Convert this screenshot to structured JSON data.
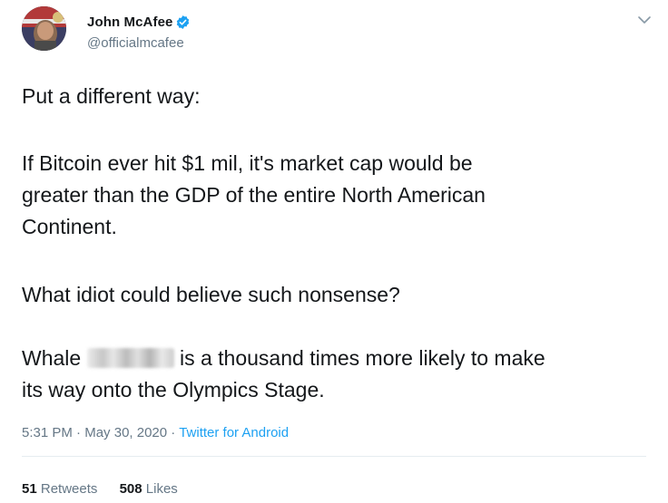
{
  "author": {
    "display_name": "John McAfee",
    "handle": "@officialmcafee",
    "verified": true
  },
  "icons": {
    "avatar": "profile-photo",
    "verified": "verified-badge-icon",
    "menu": "chevron-down-icon"
  },
  "tweet": {
    "line1": "Put a different way:",
    "line2": "If Bitcoin ever hit $1 mil, it's market cap would be",
    "line3": "greater than the GDP of the entire North American",
    "line4": "Continent.",
    "line5": "What idiot could believe such nonsense?",
    "line6_start": "Whale",
    "line6_end": "is a thousand times more likely to make",
    "line7": "its way onto the Olympics Stage."
  },
  "meta": {
    "time": "5:31 PM",
    "separator": "·",
    "date": "May 30, 2020",
    "source": "Twitter for Android"
  },
  "stats": {
    "retweets_count": "51",
    "retweets_label": "Retweets",
    "likes_count": "508",
    "likes_label": "Likes"
  },
  "colors": {
    "text": "#14171a",
    "secondary": "#657786",
    "link": "#1da1f2",
    "verified": "#1da1f2"
  }
}
